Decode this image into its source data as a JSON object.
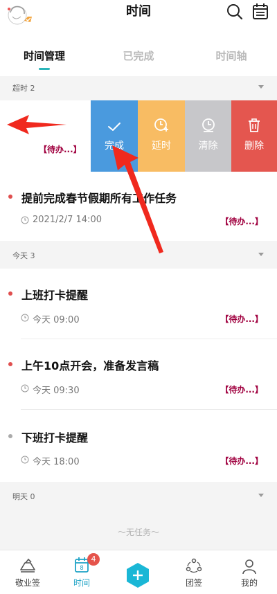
{
  "header": {
    "title": "时间"
  },
  "tabs": [
    {
      "label": "时间管理"
    },
    {
      "label": "已完成"
    },
    {
      "label": "时间轴"
    }
  ],
  "sections": {
    "overdue": {
      "label": "超时 2"
    },
    "today": {
      "label": "今天 3"
    },
    "tomorrow": {
      "label": "明天 0"
    }
  },
  "swiped_item": {
    "status": "【待办...】",
    "actions": {
      "done": "完成",
      "delay": "延时",
      "clear": "清除",
      "delete": "删除"
    }
  },
  "tasks": [
    {
      "title": "提前完成春节假期所有工作任务",
      "time": "2021/2/7 14:00",
      "status": "【待办...】"
    },
    {
      "title": "上班打卡提醒",
      "time": "今天 09:00",
      "status": "【待办...】"
    },
    {
      "title": "上午10点开会，准备发言稿",
      "time": "今天 09:30",
      "status": "【待办...】"
    },
    {
      "title": "下班打卡提醒",
      "time": "今天 18:00",
      "status": "【待办...】"
    }
  ],
  "empty_text": "～无任务～",
  "bottom_nav": [
    {
      "label": "敬业签"
    },
    {
      "label": "时间",
      "badge": "4",
      "calendar_day": "8"
    },
    {
      "label": "团签"
    },
    {
      "label": "我的"
    }
  ],
  "colors": {
    "accent": "#2bb5b9",
    "done": "#4a9ade",
    "delay": "#f8bc63",
    "clear": "#c7c7ca",
    "delete": "#e4564f",
    "status": "#a0003f",
    "arrow": "#f0291e"
  }
}
